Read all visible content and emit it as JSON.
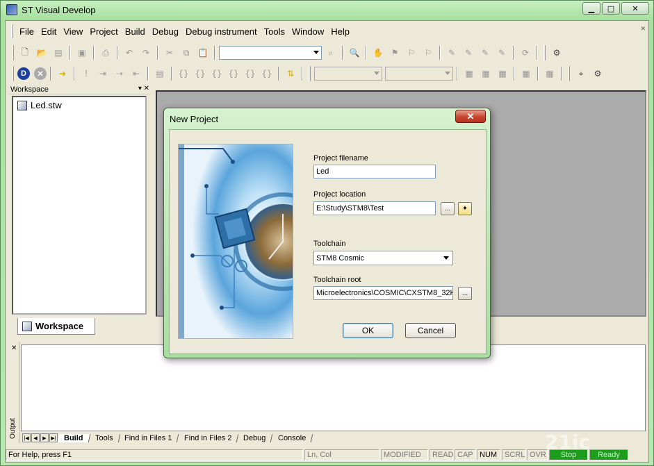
{
  "window": {
    "title": "ST Visual Develop",
    "minimize": "▭",
    "maximize": "□",
    "close": "✕"
  },
  "menu": [
    "File",
    "Edit",
    "View",
    "Project",
    "Build",
    "Debug",
    "Debug instrument",
    "Tools",
    "Window",
    "Help"
  ],
  "workspace": {
    "header": "Workspace",
    "tree_item": "Led.stw",
    "tab": "Workspace"
  },
  "output": {
    "label": "Output",
    "tabs": [
      "Build",
      "Tools",
      "Find in Files 1",
      "Find in Files 2",
      "Debug",
      "Console"
    ],
    "active_tab": "Build"
  },
  "status": {
    "help": "For Help, press F1",
    "position": "Ln, Col",
    "modified": "MODIFIED",
    "read": "READ",
    "cap": "CAP",
    "num": "NUM",
    "scrl": "SCRL",
    "ovr": "OVR",
    "stop": "Stop",
    "ready": "Ready"
  },
  "dialog": {
    "title": "New Project",
    "close": "✕",
    "project_filename_label": "Project filename",
    "project_filename": "Led",
    "project_location_label": "Project location",
    "project_location": "E:\\Study\\STM8\\Test",
    "browse": "...",
    "toolchain_label": "Toolchain",
    "toolchain": "STM8 Cosmic",
    "toolchain_root_label": "Toolchain root",
    "toolchain_root": "Microelectronics\\COSMIC\\CXSTM8_32K",
    "ok": "OK",
    "cancel": "Cancel"
  },
  "watermark": "21ic"
}
